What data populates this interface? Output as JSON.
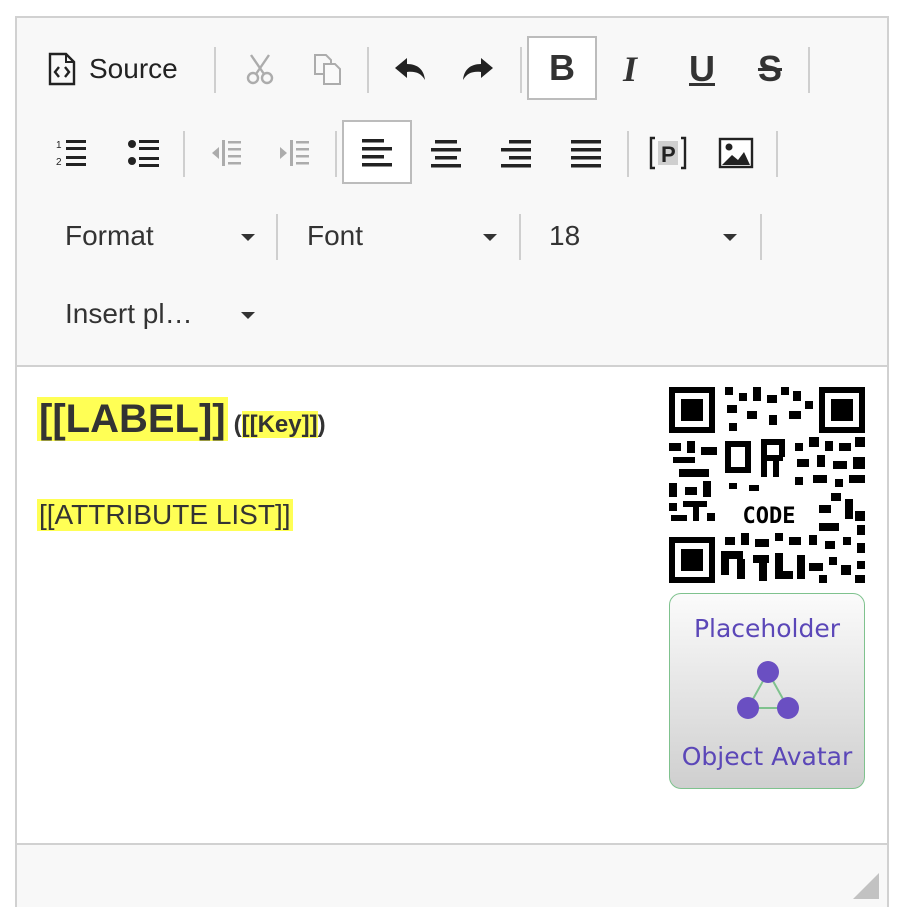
{
  "toolbar": {
    "source_label": "Source",
    "source_icon": "source-icon",
    "bold_label": "B",
    "italic_label": "I",
    "underline_label": "U",
    "strike_label": "S",
    "format_label": "Format",
    "font_label": "Font",
    "size_label": "18",
    "insert_label": "Insert pl…"
  },
  "content": {
    "label_token": "[[LABEL]]",
    "key_open": "(",
    "key_token": "[[Key]]",
    "key_close": ")",
    "attribute_token": "[[ATTRIBUTE LIST]]",
    "qr_text": "CODE",
    "avatar": {
      "line1": "Placeholder",
      "line2": "Object Avatar"
    }
  },
  "colors": {
    "highlight": "#ffff55",
    "avatar_text": "#5b47b8",
    "avatar_border": "#7fc28e",
    "toolbar_bg": "#f8f8f8",
    "border": "#d1d1d1"
  }
}
